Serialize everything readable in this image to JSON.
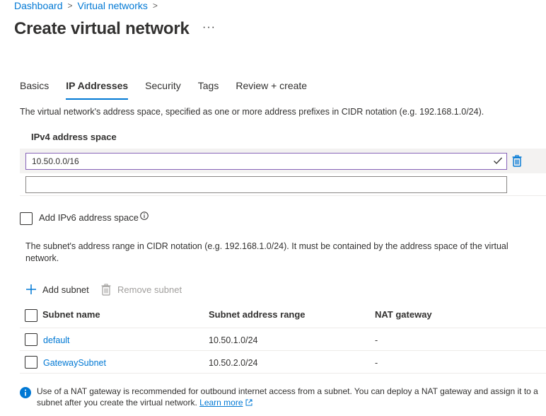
{
  "breadcrumb": {
    "items": [
      "Dashboard",
      "Virtual networks"
    ],
    "separator": ">"
  },
  "page": {
    "title": "Create virtual network",
    "more": "···"
  },
  "tabs": [
    {
      "label": "Basics",
      "active": false
    },
    {
      "label": "IP Addresses",
      "active": true
    },
    {
      "label": "Security",
      "active": false
    },
    {
      "label": "Tags",
      "active": false
    },
    {
      "label": "Review + create",
      "active": false
    }
  ],
  "address_space": {
    "description": "The virtual network's address space, specified as one or more address prefixes in CIDR notation (e.g. 192.168.1.0/24).",
    "label": "IPv4 address space",
    "entries": [
      "10.50.0.0/16"
    ],
    "empty_value": ""
  },
  "ipv6": {
    "label": "Add IPv6 address space",
    "checked": false
  },
  "subnets": {
    "description": "The subnet's address range in CIDR notation (e.g. 192.168.1.0/24). It must be contained by the address space of the virtual network.",
    "add_label": "Add subnet",
    "remove_label": "Remove subnet",
    "columns": [
      "Subnet name",
      "Subnet address range",
      "NAT gateway"
    ],
    "rows": [
      {
        "name": "default",
        "range": "10.50.1.0/24",
        "nat": "-"
      },
      {
        "name": "GatewaySubnet",
        "range": "10.50.2.0/24",
        "nat": "-"
      }
    ]
  },
  "info": {
    "text": "Use of a NAT gateway is recommended for outbound internet access from a subnet. You can deploy a NAT gateway and assign it to a subnet after you create the virtual network.",
    "link": "Learn more"
  },
  "colors": {
    "accent": "#0078d4",
    "text": "#323130",
    "focus_border": "#8764b8",
    "disabled": "#a19f9d",
    "row_highlight": "#f3f2f1"
  }
}
